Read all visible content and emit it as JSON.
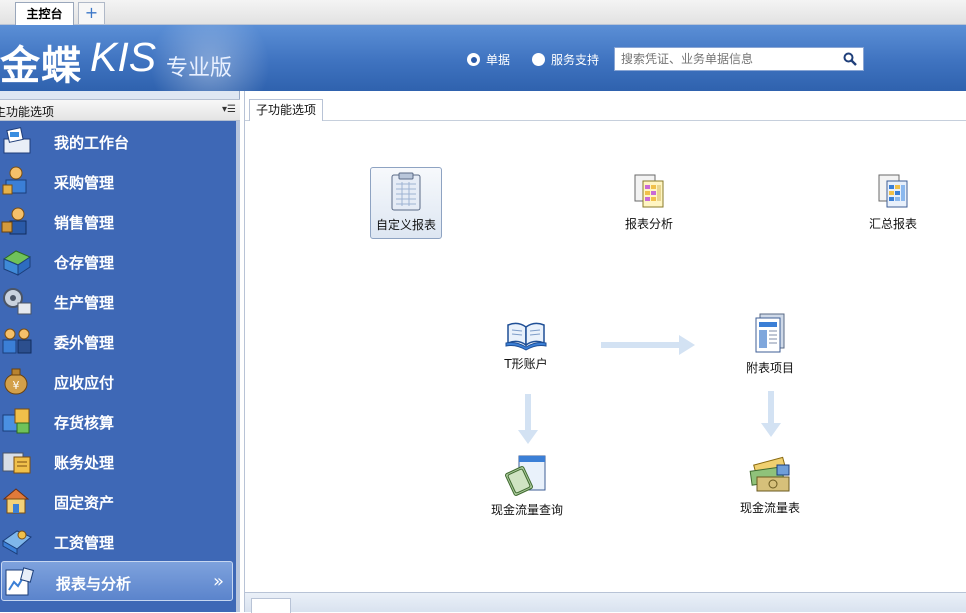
{
  "tabs": {
    "main_label": "主控台",
    "add_label": "+"
  },
  "banner": {
    "logo_cn": "金蝶",
    "logo_kis": "KIS",
    "logo_edition": "专业版",
    "radio_options": [
      {
        "label": "单据",
        "selected": true
      },
      {
        "label": "服务支持",
        "selected": false
      }
    ],
    "search_placeholder": "搜索凭证、业务单据信息"
  },
  "left_panel": {
    "title": "主功能选项",
    "items": [
      {
        "label": "我的工作台",
        "icon": "workbench-icon"
      },
      {
        "label": "采购管理",
        "icon": "purchase-icon"
      },
      {
        "label": "销售管理",
        "icon": "sales-icon"
      },
      {
        "label": "仓存管理",
        "icon": "warehouse-icon"
      },
      {
        "label": "生产管理",
        "icon": "production-icon"
      },
      {
        "label": "委外管理",
        "icon": "outsourcing-icon"
      },
      {
        "label": "应收应付",
        "icon": "receivable-icon"
      },
      {
        "label": "存货核算",
        "icon": "inventory-icon"
      },
      {
        "label": "账务处理",
        "icon": "accounting-icon"
      },
      {
        "label": "固定资产",
        "icon": "fixed-asset-icon"
      },
      {
        "label": "工资管理",
        "icon": "payroll-icon"
      },
      {
        "label": "报表与分析",
        "icon": "report-icon",
        "active": true
      }
    ],
    "expand_glyph": "»"
  },
  "main": {
    "tab_label": "子功能选项",
    "functions": [
      {
        "label": "自定义报表",
        "icon": "custom-report-icon"
      },
      {
        "label": "报表分析",
        "icon": "report-analysis-icon"
      },
      {
        "label": "汇总报表",
        "icon": "summary-report-icon"
      },
      {
        "label": "T形账户",
        "icon": "t-account-icon"
      },
      {
        "label": "附表项目",
        "icon": "schedule-item-icon"
      },
      {
        "label": "现金流量查询",
        "icon": "cash-flow-query-icon"
      },
      {
        "label": "现金流量表",
        "icon": "cash-flow-statement-icon"
      }
    ]
  },
  "colors": {
    "banner": "#3f73c0",
    "panel": "#3e68b6",
    "arrow": "#d3e2f3"
  }
}
